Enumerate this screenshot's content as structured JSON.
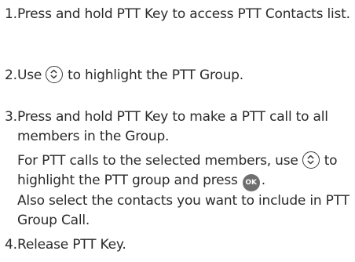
{
  "steps": [
    {
      "number": "1.",
      "text": "Press and hold PTT Key to access PTT Contacts list."
    },
    {
      "number": "2.",
      "text_before_icon": "Use",
      "icon": "navigation-key-icon",
      "text_after_icon": "to highlight the PTT Group."
    },
    {
      "number": "3.",
      "text": "Press and hold PTT Key to make a PTT call to all members in the Group.",
      "note_part1": "For PTT calls to the selected members, use",
      "note_icon1": "navigation-key-icon",
      "note_part2": "to highlight the PTT group and press",
      "note_icon2": "ok-key-icon",
      "note_icon2_label": "OK",
      "note_part3": ".",
      "note_line2": "Also select the contacts you want to include in PTT Group Call."
    },
    {
      "number": "4.",
      "text": "Release PTT Key."
    }
  ]
}
